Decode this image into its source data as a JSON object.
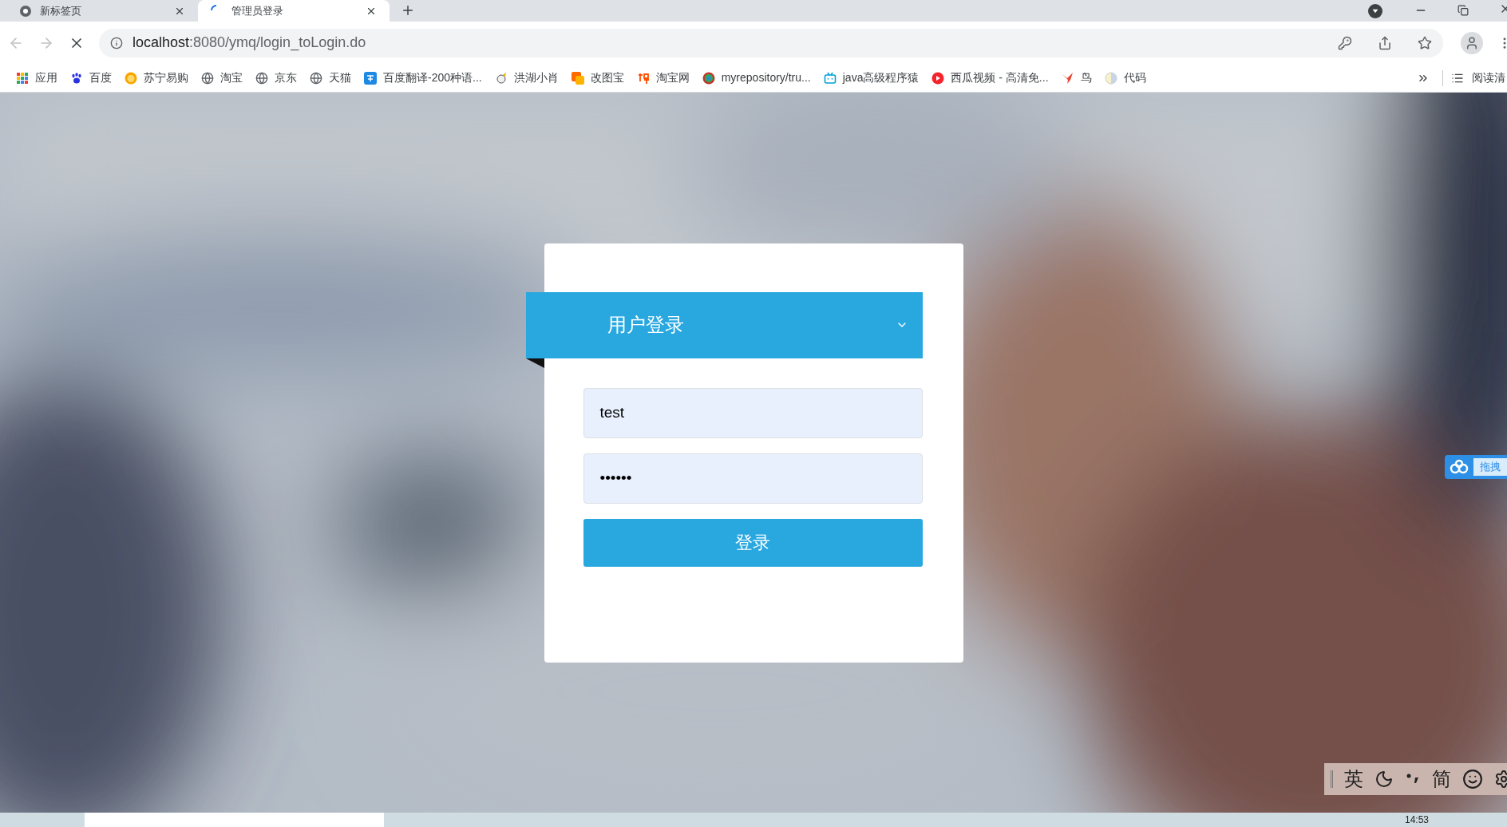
{
  "tabs": [
    {
      "title": "新标签页",
      "selected": false,
      "loading": false
    },
    {
      "title": "管理员登录",
      "selected": true,
      "loading": true
    }
  ],
  "address_bar": {
    "host": "localhost",
    "path": ":8080/ymq/login_toLogin.do"
  },
  "bookmarks": [
    {
      "label": "应用",
      "kind": "apps"
    },
    {
      "label": "百度",
      "kind": "paw"
    },
    {
      "label": "苏宁易购",
      "kind": "lion"
    },
    {
      "label": "淘宝",
      "kind": "globe"
    },
    {
      "label": "京东",
      "kind": "globe"
    },
    {
      "label": "天猫",
      "kind": "globe"
    },
    {
      "label": "百度翻译-200种语...",
      "kind": "translate"
    },
    {
      "label": "洪湖小肖",
      "kind": "bird"
    },
    {
      "label": "改图宝",
      "kind": "square"
    },
    {
      "label": "淘宝网",
      "kind": "tao"
    },
    {
      "label": "myrepository/tru...",
      "kind": "ring"
    },
    {
      "label": "java高级程序猿",
      "kind": "tv"
    },
    {
      "label": "西瓜视频 - 高清免...",
      "kind": "play"
    },
    {
      "label": "鸟",
      "kind": "swallow"
    },
    {
      "label": "代码",
      "kind": "moonball"
    }
  ],
  "reading_list": {
    "label": "阅读清"
  },
  "login": {
    "title": "用户登录",
    "username": "test",
    "password": "••••••",
    "submit": "登录"
  },
  "cloud_widget": {
    "label": "拖拽"
  },
  "ime_toolbar": {
    "mode": "英",
    "script": "简"
  },
  "taskbar": {
    "time": "14:53"
  }
}
